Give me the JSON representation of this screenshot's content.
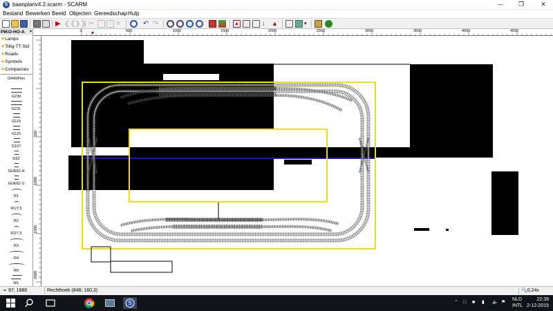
{
  "window": {
    "title": "baanplanv4.2.scarm",
    "app_icon": "scarm-app-icon"
  },
  "menu": {
    "items": [
      "Bestand",
      "Bewerken",
      "Beeld",
      "Objecten",
      "Gereedschap",
      "Hulp"
    ]
  },
  "library": {
    "selected": "PIKO-HO-A",
    "categories": [
      "Lamps",
      "Tillig-TT-Std",
      "Roads",
      "Symbols",
      "Compasses"
    ],
    "parts": [
      "G940/Flex",
      "G239",
      "G231",
      "G119",
      "G115",
      "G107",
      "G62",
      "GUE62-H",
      "GUE62-U",
      "R1",
      "R1/7,5",
      "R2",
      "R2/7,5",
      "R3",
      "R4",
      "R9",
      "WL"
    ]
  },
  "ruler": {
    "unit": "mm",
    "top_labels": [
      "0",
      "500",
      "1000",
      "1500",
      "2000",
      "2500",
      "3000",
      "3500",
      "4000",
      "4500"
    ],
    "left_labels": [
      "500",
      "1000",
      "1500",
      "2000"
    ]
  },
  "status": {
    "coords": "97; 1880",
    "object": "Rechthoek (848; 160,3)",
    "zoom": "0,24x"
  },
  "taskbar": {
    "lang_top": "NLD",
    "lang_bottom": "INTL",
    "time": "22:39",
    "date": "2-12-2015"
  },
  "colors": {
    "outer_rect": "#1a1aa8",
    "yellow_rect": "#f0e000",
    "track": "#555555"
  }
}
